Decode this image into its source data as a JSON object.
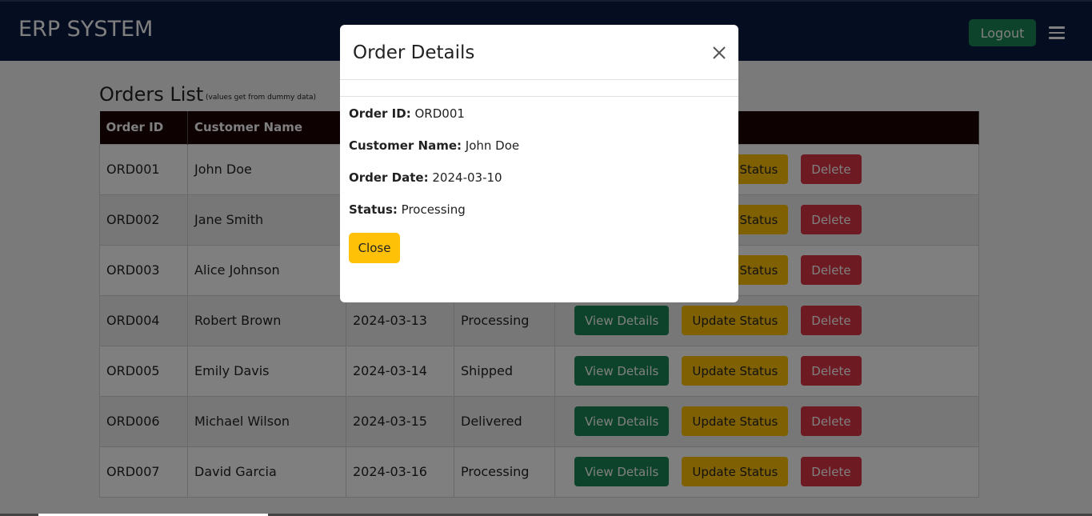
{
  "navbar": {
    "brand": "ERP SYSTEM",
    "logout_label": "Logout",
    "menu_icon": "hamburger-icon"
  },
  "page": {
    "title": "Orders List",
    "note": "(values get from dummy data)"
  },
  "table": {
    "headers": [
      "Order ID",
      "Customer Name"
    ],
    "rows": [
      {
        "id": "ORD001",
        "customer": "John Doe",
        "date": "",
        "status": ""
      },
      {
        "id": "ORD002",
        "customer": "Jane Smith",
        "date": "",
        "status": ""
      },
      {
        "id": "ORD003",
        "customer": "Alice Johnson",
        "date": "",
        "status": ""
      },
      {
        "id": "ORD004",
        "customer": "Robert Brown",
        "date": "2024-03-13",
        "status": "Processing"
      },
      {
        "id": "ORD005",
        "customer": "Emily Davis",
        "date": "2024-03-14",
        "status": "Shipped"
      },
      {
        "id": "ORD006",
        "customer": "Michael Wilson",
        "date": "2024-03-15",
        "status": "Delivered"
      },
      {
        "id": "ORD007",
        "customer": "David Garcia",
        "date": "2024-03-16",
        "status": "Processing"
      }
    ],
    "actions": {
      "view": "View Details",
      "update": "Update Status",
      "delete": "Delete"
    }
  },
  "modal": {
    "title": "Order Details",
    "close_icon": "close-icon",
    "fields": [
      {
        "label": "Order ID:",
        "value": "ORD001"
      },
      {
        "label": "Customer Name:",
        "value": "John Doe"
      },
      {
        "label": "Order Date:",
        "value": "2024-03-10"
      },
      {
        "label": "Status:",
        "value": "Processing"
      }
    ],
    "close_label": "Close"
  },
  "colors": {
    "navbar": "#0b1a40",
    "success": "#198754",
    "warning": "#ffc107",
    "danger": "#dc3545",
    "table_header": "#1a0305"
  }
}
